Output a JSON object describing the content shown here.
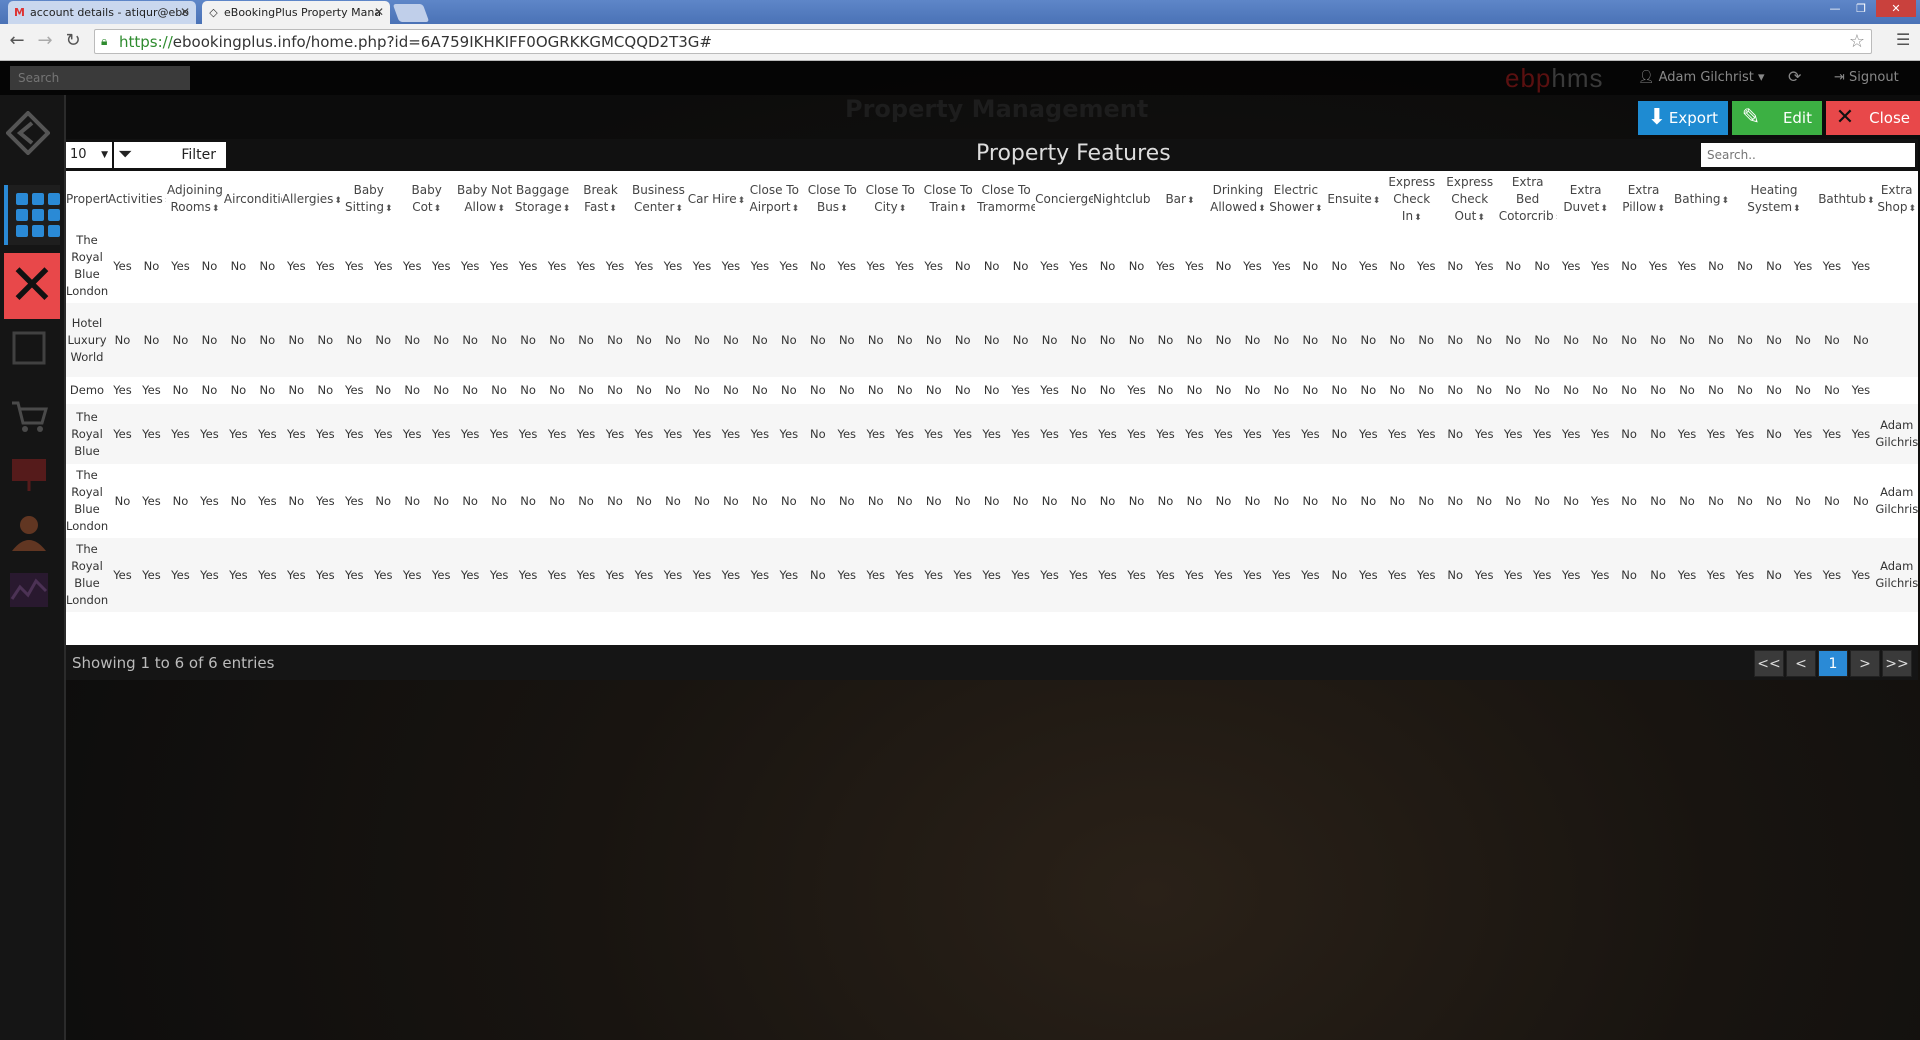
{
  "browser": {
    "tabs": [
      {
        "label": "account details - atiqur@ebo",
        "icon": "gmail-icon"
      },
      {
        "label": "eBookingPlus Property Mana",
        "icon": "ebp-icon"
      }
    ],
    "url_scheme": "https://",
    "url_rest": "ebookingplus.info/home.php?id=6A759IKHKIFF0OGRKKGMCQQD2T3G#"
  },
  "app": {
    "search_placeholder": "Search",
    "brand": "ebp",
    "brand_suffix": "hms",
    "user": "Adam Gilchrist",
    "signout": "Signout",
    "bg_title": "Property Management"
  },
  "actions": {
    "export": "Export",
    "edit": "Edit",
    "close": "Close"
  },
  "table": {
    "title": "Property Features",
    "page_size": "10",
    "filter_label": "Filter",
    "search_placeholder": "Search..",
    "columns": [
      "Property",
      "Activities",
      "Adjoining Rooms",
      "Aircondition",
      "Allergies",
      "Baby Sitting",
      "Baby Cot",
      "Baby Not Allow",
      "Baggage Storage",
      "Break Fast",
      "Business Center",
      "Car Hire",
      "Close To Airport",
      "Close To Bus",
      "Close To City",
      "Close To Train",
      "Close To Tramormetro",
      "Concierge",
      "Nightclub",
      "Bar",
      "Drinking Allowed",
      "Electric Shower",
      "Ensuite",
      "Express Check In",
      "Express Check Out",
      "Extra Bed Cotorcrib",
      "Extra Duvet",
      "Extra Pillow",
      "Bathing",
      "Heating System",
      "Bathtub",
      "Extra Shop"
    ],
    "rows": [
      {
        "property": "The Royal Blue London",
        "extra": "",
        "values": [
          "Yes",
          "No",
          "Yes",
          "No",
          "No",
          "No",
          "Yes",
          "Yes",
          "Yes",
          "Yes",
          "Yes",
          "Yes",
          "Yes",
          "Yes",
          "Yes",
          "Yes",
          "Yes",
          "Yes",
          "Yes",
          "Yes",
          "Yes",
          "Yes",
          "Yes",
          "Yes",
          "No",
          "Yes",
          "Yes",
          "Yes",
          "Yes",
          "No",
          "No",
          "No",
          "Yes",
          "Yes",
          "No",
          "No",
          "Yes",
          "Yes",
          "No",
          "Yes",
          "Yes",
          "No",
          "No",
          "Yes",
          "No",
          "Yes",
          "No",
          "Yes",
          "No",
          "No",
          "Yes",
          "Yes",
          "No",
          "Yes",
          "Yes",
          "No",
          "No",
          "No",
          "Yes",
          "Yes",
          "Yes"
        ]
      },
      {
        "property": "Hotel Luxury World",
        "extra": "",
        "values": [
          "No",
          "No",
          "No",
          "No",
          "No",
          "No",
          "No",
          "No",
          "No",
          "No",
          "No",
          "No",
          "No",
          "No",
          "No",
          "No",
          "No",
          "No",
          "No",
          "No",
          "No",
          "No",
          "No",
          "No",
          "No",
          "No",
          "No",
          "No",
          "No",
          "No",
          "No",
          "No",
          "No",
          "No",
          "No",
          "No",
          "No",
          "No",
          "No",
          "No",
          "No",
          "No",
          "No",
          "No",
          "No",
          "No",
          "No",
          "No",
          "No",
          "No",
          "No",
          "No",
          "No",
          "No",
          "No",
          "No",
          "No",
          "No",
          "No",
          "No",
          "No"
        ]
      },
      {
        "property": "Demo",
        "extra": "",
        "values": [
          "Yes",
          "Yes",
          "No",
          "No",
          "No",
          "No",
          "No",
          "No",
          "Yes",
          "No",
          "No",
          "No",
          "No",
          "No",
          "No",
          "No",
          "No",
          "No",
          "No",
          "No",
          "No",
          "No",
          "No",
          "No",
          "No",
          "No",
          "No",
          "No",
          "No",
          "No",
          "No",
          "Yes",
          "Yes",
          "No",
          "No",
          "Yes",
          "No",
          "No",
          "No",
          "No",
          "No",
          "No",
          "No",
          "No",
          "No",
          "No",
          "No",
          "No",
          "No",
          "No",
          "No",
          "No",
          "No",
          "No",
          "No",
          "No",
          "No",
          "No",
          "No",
          "No",
          "Yes"
        ]
      },
      {
        "property": "The Royal Blue",
        "extra": "Adam Gilchrist",
        "values": [
          "Yes",
          "Yes",
          "Yes",
          "Yes",
          "Yes",
          "Yes",
          "Yes",
          "Yes",
          "Yes",
          "Yes",
          "Yes",
          "Yes",
          "Yes",
          "Yes",
          "Yes",
          "Yes",
          "Yes",
          "Yes",
          "Yes",
          "Yes",
          "Yes",
          "Yes",
          "Yes",
          "Yes",
          "No",
          "Yes",
          "Yes",
          "Yes",
          "Yes",
          "Yes",
          "Yes",
          "Yes",
          "Yes",
          "Yes",
          "Yes",
          "Yes",
          "Yes",
          "Yes",
          "Yes",
          "Yes",
          "Yes",
          "Yes",
          "No",
          "Yes",
          "Yes",
          "Yes",
          "No",
          "Yes",
          "Yes",
          "Yes",
          "Yes",
          "Yes",
          "No",
          "No",
          "Yes",
          "Yes",
          "Yes",
          "No",
          "Yes",
          "Yes",
          "Yes"
        ]
      },
      {
        "property": "The Royal Blue London",
        "extra": "Adam Gilchrist",
        "values": [
          "No",
          "Yes",
          "No",
          "Yes",
          "No",
          "Yes",
          "No",
          "Yes",
          "Yes",
          "No",
          "No",
          "No",
          "No",
          "No",
          "No",
          "No",
          "No",
          "No",
          "No",
          "No",
          "No",
          "No",
          "No",
          "No",
          "No",
          "No",
          "No",
          "No",
          "No",
          "No",
          "No",
          "No",
          "No",
          "No",
          "No",
          "No",
          "No",
          "No",
          "No",
          "No",
          "No",
          "No",
          "No",
          "No",
          "No",
          "No",
          "No",
          "No",
          "No",
          "No",
          "No",
          "Yes",
          "No",
          "No",
          "No",
          "No",
          "No",
          "No",
          "No",
          "No",
          "No"
        ]
      },
      {
        "property": "The Royal Blue London",
        "extra": "Adam Gilchrist",
        "values": [
          "Yes",
          "Yes",
          "Yes",
          "Yes",
          "Yes",
          "Yes",
          "Yes",
          "Yes",
          "Yes",
          "Yes",
          "Yes",
          "Yes",
          "Yes",
          "Yes",
          "Yes",
          "Yes",
          "Yes",
          "Yes",
          "Yes",
          "Yes",
          "Yes",
          "Yes",
          "Yes",
          "Yes",
          "No",
          "Yes",
          "Yes",
          "Yes",
          "Yes",
          "Yes",
          "Yes",
          "Yes",
          "Yes",
          "Yes",
          "Yes",
          "Yes",
          "Yes",
          "Yes",
          "Yes",
          "Yes",
          "Yes",
          "Yes",
          "No",
          "Yes",
          "Yes",
          "Yes",
          "No",
          "Yes",
          "Yes",
          "Yes",
          "Yes",
          "Yes",
          "No",
          "No",
          "Yes",
          "Yes",
          "Yes",
          "No",
          "Yes",
          "Yes",
          "Yes"
        ]
      }
    ],
    "showing": "Showing 1 to 6 of 6 entries",
    "pagination": [
      "<<",
      "<",
      "1",
      ">",
      ">>"
    ]
  },
  "colors": {
    "accent": "#2a8ad6",
    "export": "#1e8bd2",
    "edit": "#3cb043",
    "close": "#e8484a"
  }
}
